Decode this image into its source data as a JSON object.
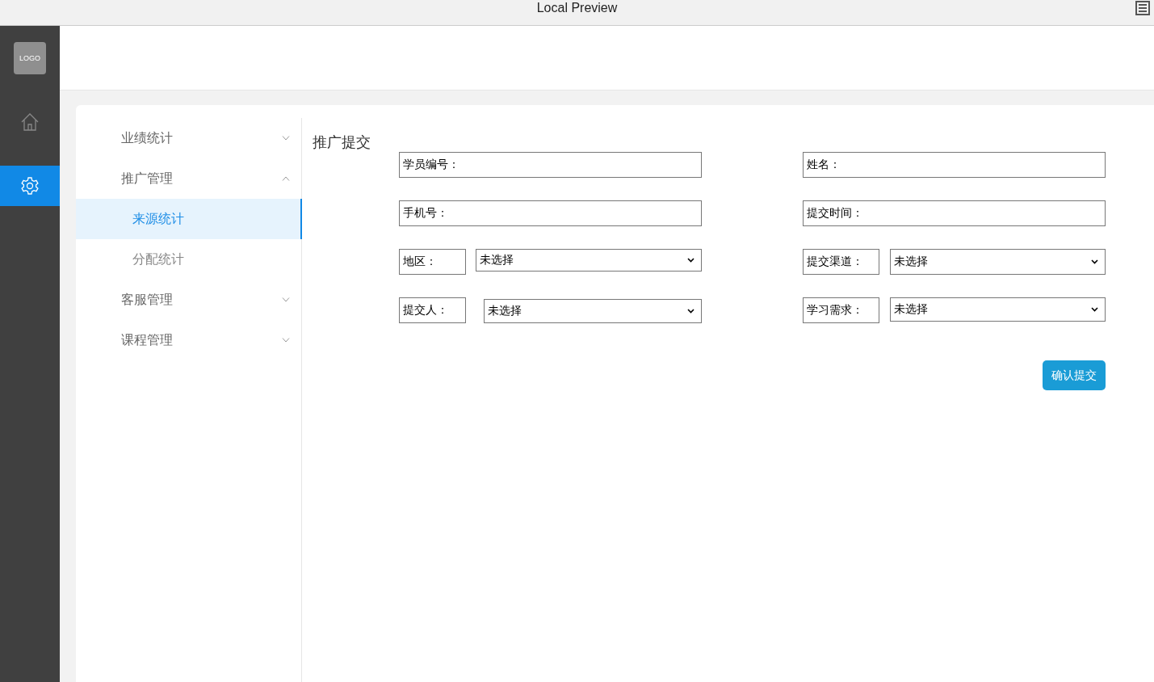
{
  "window": {
    "title": "Local Preview"
  },
  "rail": {
    "logo": "LOGO",
    "items": [
      {
        "kind": "home",
        "selected": false
      },
      {
        "kind": "settings",
        "selected": true
      }
    ]
  },
  "menu": [
    {
      "label": "业绩统计",
      "expanded": false
    },
    {
      "label": "推广管理",
      "expanded": true,
      "children": [
        {
          "label": "来源统计",
          "selected": true
        },
        {
          "label": "分配统计",
          "selected": false
        }
      ]
    },
    {
      "label": "客服管理",
      "expanded": false
    },
    {
      "label": "课程管理",
      "expanded": false
    }
  ],
  "page_title": "推广提交",
  "form": {
    "columns": [
      [
        {
          "kind": "text",
          "label": "学员编号："
        },
        {
          "kind": "text",
          "label": "手机号："
        },
        {
          "kind": "select",
          "label": "地区：",
          "value": "未选择"
        },
        {
          "kind": "select",
          "label": "提交人：",
          "value": "未选择"
        }
      ],
      [
        {
          "kind": "text",
          "label": "姓名："
        },
        {
          "kind": "text",
          "label": "提交时间："
        },
        {
          "kind": "select",
          "label": "提交渠道：",
          "value": "未选择"
        },
        {
          "kind": "select",
          "label": "学习需求：",
          "value": "未选择"
        }
      ]
    ],
    "submit": "确认提交"
  }
}
